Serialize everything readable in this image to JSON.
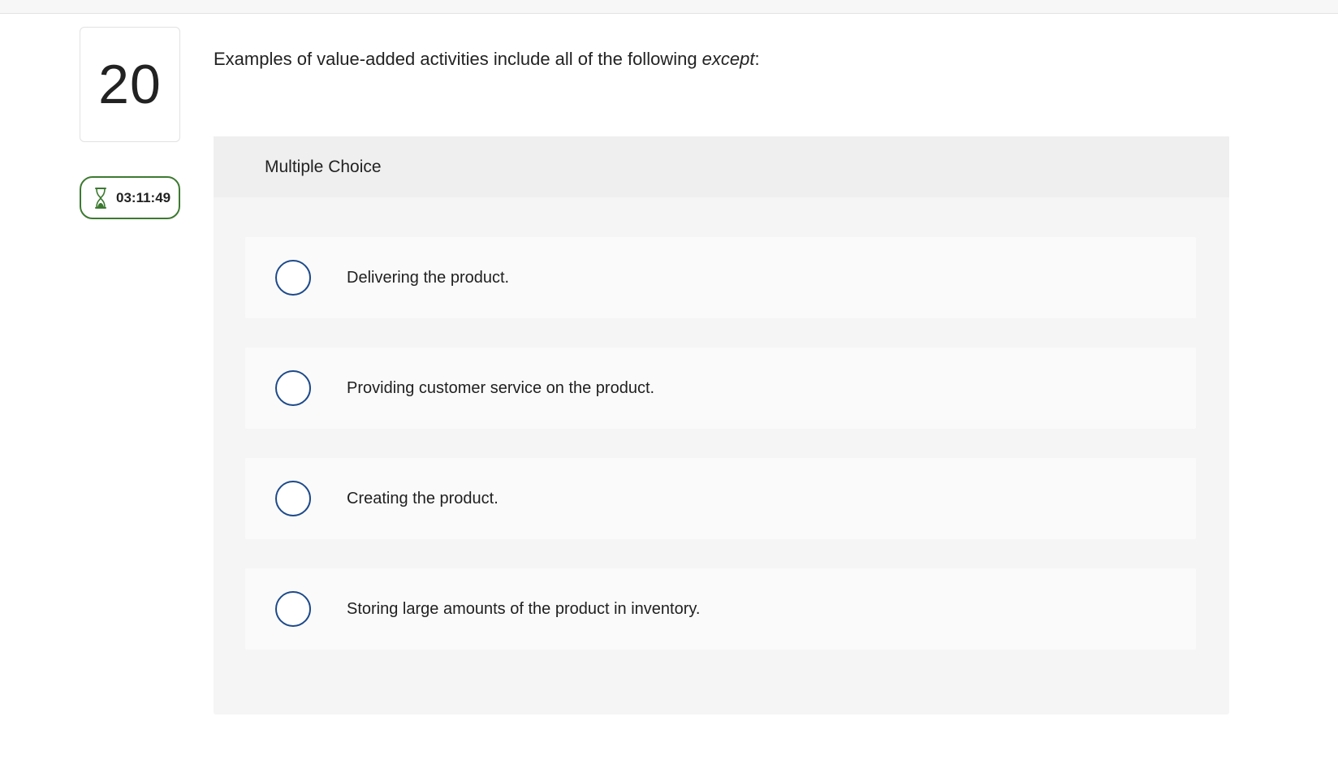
{
  "question": {
    "number": "20",
    "text": "Examples of value-added activities include all of the following ",
    "emphasis": "except",
    "suffix": ":"
  },
  "timer": {
    "icon": "hourglass-icon",
    "value": "03:11:49",
    "color": "#3d7a31"
  },
  "panel": {
    "type_label": "Multiple Choice"
  },
  "options": [
    {
      "label": "Delivering the product.",
      "selected": false
    },
    {
      "label": "Providing customer service on the product.",
      "selected": false
    },
    {
      "label": "Creating the product.",
      "selected": false
    },
    {
      "label": "Storing large amounts of the product in inventory.",
      "selected": false
    }
  ],
  "colors": {
    "radio_border": "#1d4a8a",
    "panel_bg": "#f5f5f5",
    "option_bg": "#fafafa"
  }
}
